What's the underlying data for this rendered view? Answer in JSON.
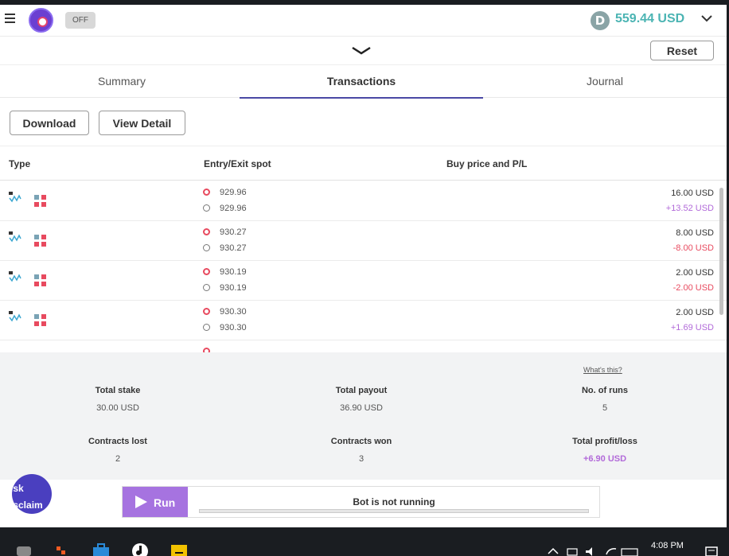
{
  "header": {
    "toggle_label": "OFF",
    "balance_currency_icon": "D",
    "balance": "559.44 USD",
    "reset_label": "Reset"
  },
  "tabs": [
    {
      "label": "Summary",
      "active": false
    },
    {
      "label": "Transactions",
      "active": true
    },
    {
      "label": "Journal",
      "active": false
    }
  ],
  "actions": {
    "download_label": "Download",
    "view_detail_label": "View Detail"
  },
  "table": {
    "columns": [
      "Type",
      "Entry/Exit spot",
      "Buy price and P/L"
    ],
    "rows": [
      {
        "entry": "929.96",
        "exit": "929.96",
        "buy_price": "16.00 USD",
        "pl": "+13.52 USD",
        "pl_color": "#b26ad9"
      },
      {
        "entry": "930.27",
        "exit": "930.27",
        "buy_price": "8.00 USD",
        "pl": "-8.00 USD",
        "pl_color": "#e84a5f"
      },
      {
        "entry": "930.19",
        "exit": "930.19",
        "buy_price": "2.00 USD",
        "pl": "-2.00 USD",
        "pl_color": "#e84a5f"
      },
      {
        "entry": "930.30",
        "exit": "930.30",
        "buy_price": "2.00 USD",
        "pl": "+1.69 USD",
        "pl_color": "#b26ad9"
      }
    ]
  },
  "summary": {
    "whats_this": "What's this?",
    "total_stake_label": "Total stake",
    "total_stake": "30.00 USD",
    "total_payout_label": "Total payout",
    "total_payout": "36.90 USD",
    "runs_label": "No. of runs",
    "runs": "5",
    "lost_label": "Contracts lost",
    "lost": "2",
    "won_label": "Contracts won",
    "won": "3",
    "profit_label": "Total profit/loss",
    "profit": "+6.90 USD"
  },
  "run_panel": {
    "run_label": "Run",
    "status": "Bot is not running"
  },
  "floating": {
    "label": "isk\nisclaim"
  },
  "taskbar": {
    "time": "4:08 PM"
  },
  "colors": {
    "accent": "#4a49a5",
    "balance": "#4bb4b3",
    "profit": "#b26ad9",
    "loss": "#e84a5f",
    "run_button": "#a673e0"
  }
}
